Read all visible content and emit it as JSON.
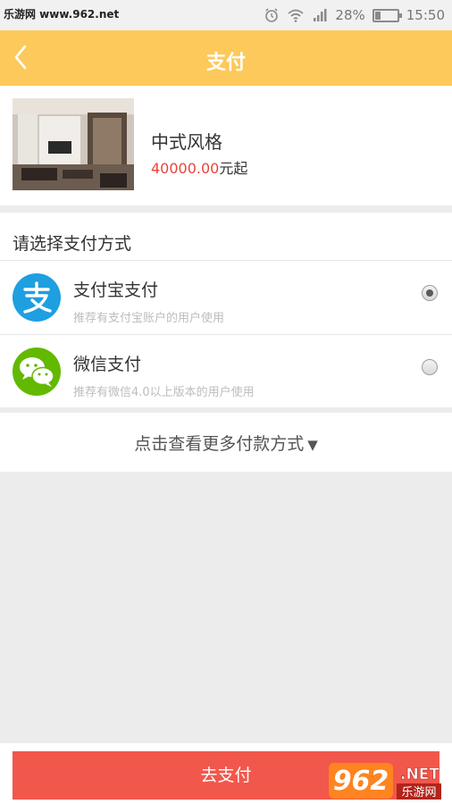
{
  "status_bar": {
    "watermark": "乐游网 www.962.net",
    "battery": "28%",
    "battery_level": 0.28,
    "time": "15:50"
  },
  "header": {
    "title": "支付",
    "back_icon": "chevron-left-icon"
  },
  "product": {
    "name": "中式风格",
    "price": "40000.00",
    "price_suffix": "元起"
  },
  "payment": {
    "heading": "请选择支付方式",
    "options": [
      {
        "name": "支付宝支付",
        "description": "推荐有支付宝账户的用户使用",
        "icon": "alipay-icon",
        "selected": true
      },
      {
        "name": "微信支付",
        "description": "推荐有微信4.0以上版本的用户使用",
        "icon": "wechat-icon",
        "selected": false
      }
    ]
  },
  "more": {
    "label": "点击查看更多付款方式",
    "arrow": "▼"
  },
  "footer": {
    "pay_button": "去支付",
    "brand": {
      "logo_text": "962",
      "logo_suffix": ".NET",
      "site_name": "乐游网"
    }
  },
  "colors": {
    "header_bg": "#fdc95a",
    "price": "#e8463b",
    "pay_button": "#f2574c",
    "alipay": "#1e9fe0",
    "wechat": "#62b900"
  }
}
